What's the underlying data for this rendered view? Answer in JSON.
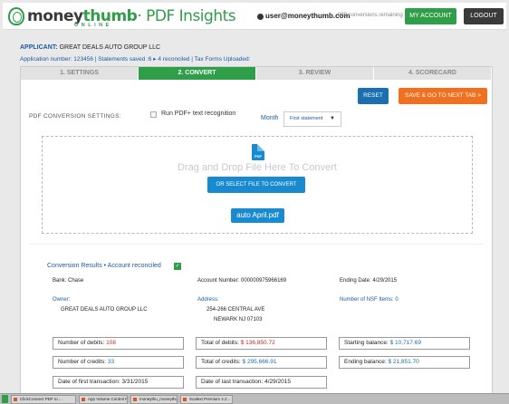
{
  "header": {
    "logo_main_a": "money",
    "logo_main_b": "thumb",
    "logo_product": "· PDF Insights",
    "logo_sub": "ONLINE",
    "user_email": "user@moneythumb.com",
    "conversions_remaining": "989 conversions remaining",
    "my_account_label": "MY ACCOUNT",
    "logout_label": "LOGOUT"
  },
  "applicant": {
    "label": "APPLICANT:",
    "name": "GREAT DEALS AUTO GROUP LLC",
    "line2": "Application number: 123456  |  Statements saved :6  ▸  4 reconciled  |  Tax Forms Uploaded:"
  },
  "steps": [
    "1. SETTINGS",
    "2. CONVERT",
    "3. REVIEW",
    "4. SCORECARD"
  ],
  "active_step": 1,
  "actions": {
    "reset_label": "RESET",
    "save_label": "SAVE & GO TO NEXT TAB >"
  },
  "settings": {
    "label": "PDF CONVERSION SETTINGS:",
    "ocr_label": "Run PDF+ text recognition",
    "ocr_checked": false,
    "month_label": "Month",
    "month_value": "First statement"
  },
  "dropzone": {
    "icon_text": "PDF",
    "text": "Drag and Drop File Here To Convert",
    "select_label": "OR SELECT FILE TO CONVERT",
    "file_name": "auto April.pdf"
  },
  "results": {
    "title": "Conversion Results  •  Account reconciled",
    "check": "✓",
    "bank": "Bank: Chase",
    "account_number": "Account Number: 000000975966169",
    "ending_date": "Ending Date: 4/29/2015",
    "owner_label": "Owner:",
    "owner_value": "GREAT DEALS AUTO GROUP LLC",
    "address_label": "Address:",
    "address_line1": "254-266 CENTRAL AVE",
    "address_line2": "NEWARK NJ 07103",
    "nsf_label": "Number of NSF Items: 0",
    "debits_label": "Number of debits:",
    "debits_value": "108",
    "total_debits_label": "Total of debits:",
    "total_debits_value": "$ 136,850.72",
    "starting_label": "Starting balance:",
    "starting_value": "$ 10,717.69",
    "credits_label": "Number of credits:",
    "credits_value": "33",
    "total_credits_label": "Total of credits:",
    "total_credits_value": "$ 295,666.91",
    "ending_label": "Ending balance:",
    "ending_value": "$ 21,851.70",
    "first_tx": "Date of first transaction: 3/31/2015",
    "last_tx": "Date of last transaction: 4/29/2015"
  },
  "taskbar": [
    "ClickConnect PDF to ...",
    "App Volume Control P...",
    "moneythu_moneythu...",
    "Scalext Premium 4.2..."
  ],
  "colors": {
    "brand_green": "#2e9e48",
    "link_blue": "#1a5a9e",
    "button_blue": "#1a6fb0",
    "orange": "#f07020",
    "dark": "#3a3a3a"
  }
}
